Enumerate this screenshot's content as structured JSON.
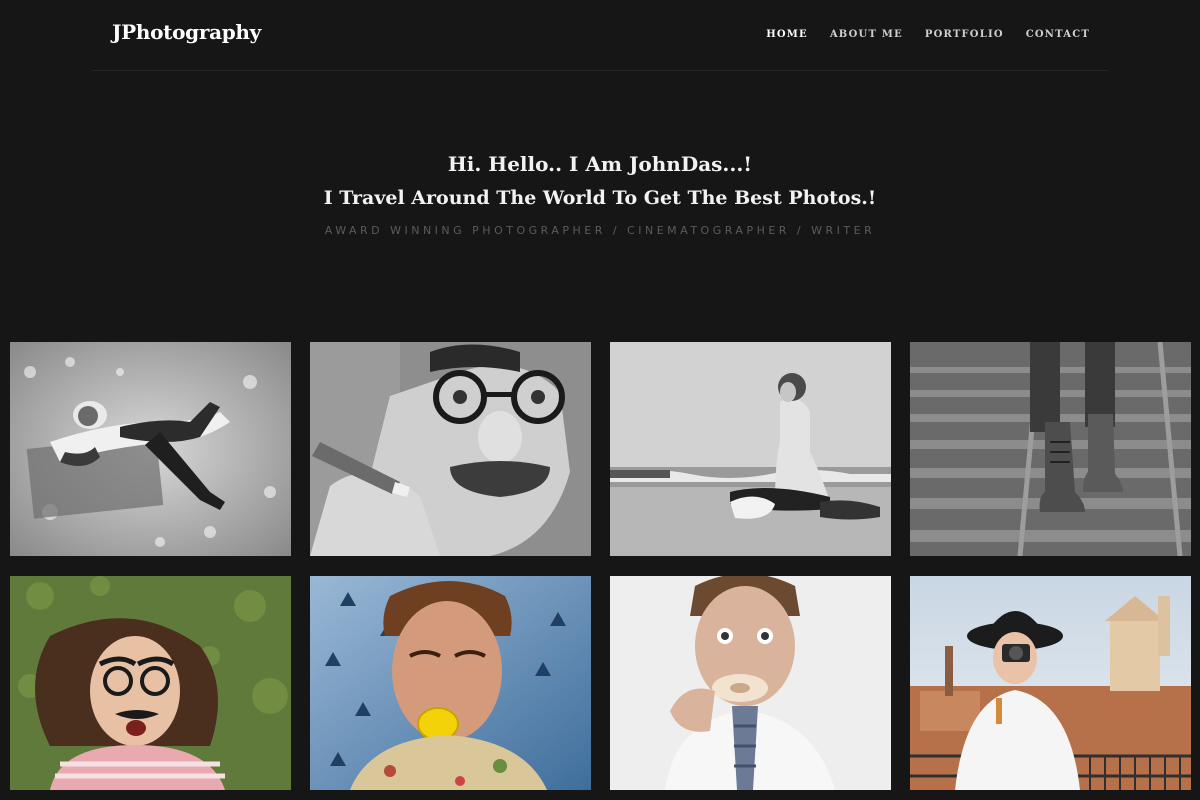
{
  "header": {
    "logo": "JPhotography",
    "nav": [
      {
        "label": "HOME",
        "active": true
      },
      {
        "label": "ABOUT ME",
        "active": false
      },
      {
        "label": "PORTFOLIO",
        "active": false
      },
      {
        "label": "CONTACT",
        "active": false
      }
    ]
  },
  "hero": {
    "greeting": "Hi. Hello.. I Am JohnDas...!",
    "headline": "I Travel Around The World To Get The Best Photos.!",
    "tagline": "AWARD WINNING PHOTOGRAPHER  / CINEMATOGRAPHER / WRITER"
  },
  "gallery": {
    "photos": [
      {
        "subject": "person-lying-in-snow",
        "style": "grayscale"
      },
      {
        "subject": "man-with-glasses-and-mustache-cigar",
        "style": "grayscale"
      },
      {
        "subject": "woman-sitting-on-beach",
        "style": "grayscale"
      },
      {
        "subject": "boots-on-railway",
        "style": "grayscale"
      },
      {
        "subject": "woman-on-grass-with-disguise-glasses",
        "style": "color"
      },
      {
        "subject": "man-biting-lemon",
        "style": "color"
      },
      {
        "subject": "man-eating-donut",
        "style": "color"
      },
      {
        "subject": "woman-with-camera-and-hat",
        "style": "color"
      }
    ]
  },
  "colors": {
    "background": "#161616",
    "text": "#f2f2f2",
    "tagline": "#5b5b5b",
    "nav": "#cfcfcf"
  }
}
